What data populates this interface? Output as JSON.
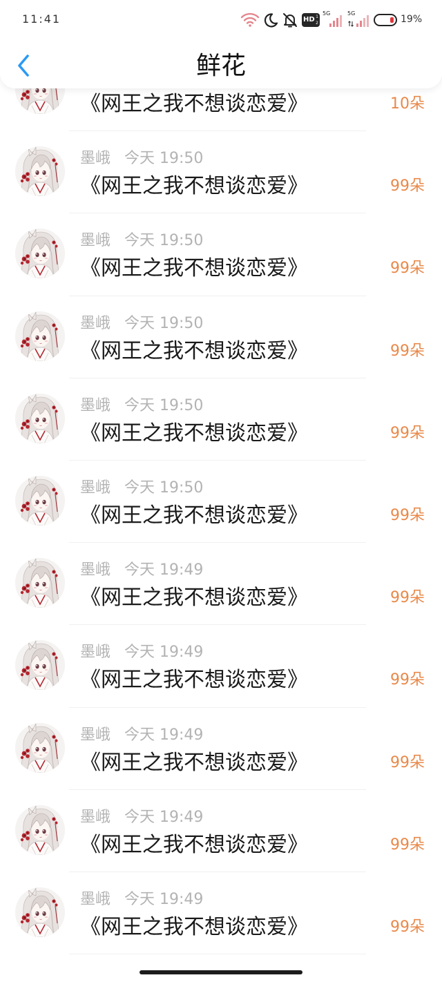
{
  "status_bar": {
    "time": "11:41",
    "hd_badge": "HD",
    "hd_sup": "1",
    "hd_sub": "2",
    "signal_1_label": "5G",
    "signal_2_label": "5G",
    "battery_text": "19%",
    "battery_level": 0.19,
    "icons": [
      "wifi-icon",
      "moon-icon",
      "bell-off-icon",
      "hd-icon",
      "signal-bars-icon",
      "signal-bars-icon",
      "battery-icon"
    ]
  },
  "header": {
    "title": "鲜花",
    "back_icon": "chevron-left-icon"
  },
  "colors": {
    "accent": "#2b9af3",
    "flower_count": "#e8894a",
    "meta_text": "#b3b3b3",
    "title_text": "#1a1a1a"
  },
  "gifts": [
    {
      "book": "《网王之我不想谈恋爱》",
      "amount": "10朵"
    },
    {
      "user": "墨峨",
      "time": "今天 19:50",
      "book": "《网王之我不想谈恋爱》",
      "amount": "99朵"
    },
    {
      "user": "墨峨",
      "time": "今天 19:50",
      "book": "《网王之我不想谈恋爱》",
      "amount": "99朵"
    },
    {
      "user": "墨峨",
      "time": "今天 19:50",
      "book": "《网王之我不想谈恋爱》",
      "amount": "99朵"
    },
    {
      "user": "墨峨",
      "time": "今天 19:50",
      "book": "《网王之我不想谈恋爱》",
      "amount": "99朵"
    },
    {
      "user": "墨峨",
      "time": "今天 19:50",
      "book": "《网王之我不想谈恋爱》",
      "amount": "99朵"
    },
    {
      "user": "墨峨",
      "time": "今天 19:49",
      "book": "《网王之我不想谈恋爱》",
      "amount": "99朵"
    },
    {
      "user": "墨峨",
      "time": "今天 19:49",
      "book": "《网王之我不想谈恋爱》",
      "amount": "99朵"
    },
    {
      "user": "墨峨",
      "time": "今天 19:49",
      "book": "《网王之我不想谈恋爱》",
      "amount": "99朵"
    },
    {
      "user": "墨峨",
      "time": "今天 19:49",
      "book": "《网王之我不想谈恋爱》",
      "amount": "99朵"
    },
    {
      "user": "墨峨",
      "time": "今天 19:49",
      "book": "《网王之我不想谈恋爱》",
      "amount": "99朵"
    }
  ]
}
